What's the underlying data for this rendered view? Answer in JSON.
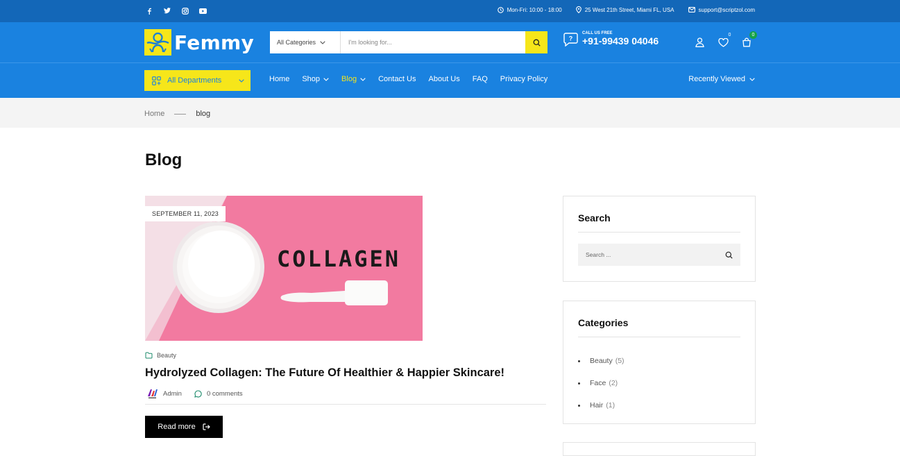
{
  "colors": {
    "topbar": "#1367b8",
    "primary": "#1a82e0",
    "accent": "#f6e61a",
    "badge_green": "#16a34a"
  },
  "topbar": {
    "social_icons": [
      "facebook-icon",
      "twitter-icon",
      "instagram-icon",
      "youtube-icon"
    ],
    "hours": "Mon-Fri: 10:00 - 18:00",
    "address": "25 West 21th Street, Miami FL, USA",
    "email": "support@scriptzol.com"
  },
  "header": {
    "logo_text": "Femmy",
    "category_select": "All Categories",
    "search_placeholder": "I'm looking for...",
    "call_label": "CALL US FREE",
    "phone": "+91-99439 04046",
    "wishlist_count": "0",
    "cart_count": "0"
  },
  "nav": {
    "all_departments": "All Departments",
    "items": [
      "Home",
      "Shop",
      "Blog",
      "Contact Us",
      "About Us",
      "FAQ",
      "Privacy Policy"
    ],
    "recently_viewed": "Recently Viewed"
  },
  "breadcrumb": {
    "home": "Home",
    "current": "blog"
  },
  "page": {
    "title": "Blog"
  },
  "post": {
    "date": "SEPTEMBER 11, 2023",
    "image_text": "COLLAGEN",
    "category": "Beauty",
    "title": "Hydrolyzed Collagen: The Future Of Healthier & Happier Skincare!",
    "author": "Admin",
    "comments": "0 comments",
    "read_more": "Read more"
  },
  "sidebar": {
    "search_title": "Search",
    "search_placeholder": "Search ...",
    "categories_title": "Categories",
    "categories": [
      {
        "name": "Beauty",
        "count": "(5)"
      },
      {
        "name": "Face",
        "count": "(2)"
      },
      {
        "name": "Hair",
        "count": "(1)"
      }
    ]
  }
}
